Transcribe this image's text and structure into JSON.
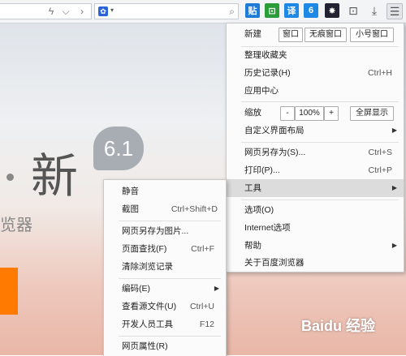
{
  "page": {
    "big_char": "新",
    "version": "6.1",
    "side_text": "览器",
    "watermark": "Baidu 经验"
  },
  "toolbar": {
    "lightning_icon": "lightning-icon",
    "dropdown_icon": "chevron-down-icon",
    "forward_icon": "chevron-right-icon",
    "search_icon": "search-icon",
    "icons": [
      {
        "name": "tie-icon",
        "glyph": "贴",
        "color": "#1e7bd6"
      },
      {
        "name": "crop-icon",
        "glyph": "⊡",
        "color": "#2a9d3a"
      },
      {
        "name": "translate-icon",
        "glyph": "译",
        "color": "#1e88e5"
      },
      {
        "name": "app-icon",
        "glyph": "6",
        "color": "#1e88e5"
      },
      {
        "name": "gear-icon",
        "glyph": "✸",
        "color": "#223"
      },
      {
        "name": "bookmark-icon",
        "glyph": "★",
        "color": "#555"
      },
      {
        "name": "download-icon",
        "glyph": "⤓",
        "color": "#555"
      },
      {
        "name": "menu-icon",
        "glyph": "☰",
        "color": "#444"
      }
    ]
  },
  "main_menu": {
    "new_label": "新建",
    "new_window": "窗口",
    "incognito_window": "无痕窗口",
    "small_window": "小号窗口",
    "organize_favorites": "整理收藏夹",
    "history": "历史记录(H)",
    "history_shortcut": "Ctrl+H",
    "app_center": "应用中心",
    "zoom": "缩放",
    "zoom_minus": "-",
    "zoom_value": "100%",
    "zoom_plus": "+",
    "fullscreen": "全屏显示",
    "custom_layout": "自定义界面布局",
    "save_as": "网页另存为(S)...",
    "save_as_shortcut": "Ctrl+S",
    "print": "打印(P)...",
    "print_shortcut": "Ctrl+P",
    "tools": "工具",
    "options": "选项(O)",
    "internet_options": "Internet选项",
    "help": "帮助",
    "about": "关于百度浏览器"
  },
  "sub_menu": {
    "mute": "静音",
    "screenshot": "截图",
    "screenshot_shortcut": "Ctrl+Shift+D",
    "save_as_image": "网页另存为图片...",
    "find": "页面查找(F)",
    "find_shortcut": "Ctrl+F",
    "clear_history": "清除浏览记录",
    "encoding": "编码(E)",
    "view_source": "查看源文件(U)",
    "view_source_shortcut": "Ctrl+U",
    "dev_tools": "开发人员工具",
    "dev_tools_shortcut": "F12",
    "page_properties": "网页属性(R)"
  }
}
